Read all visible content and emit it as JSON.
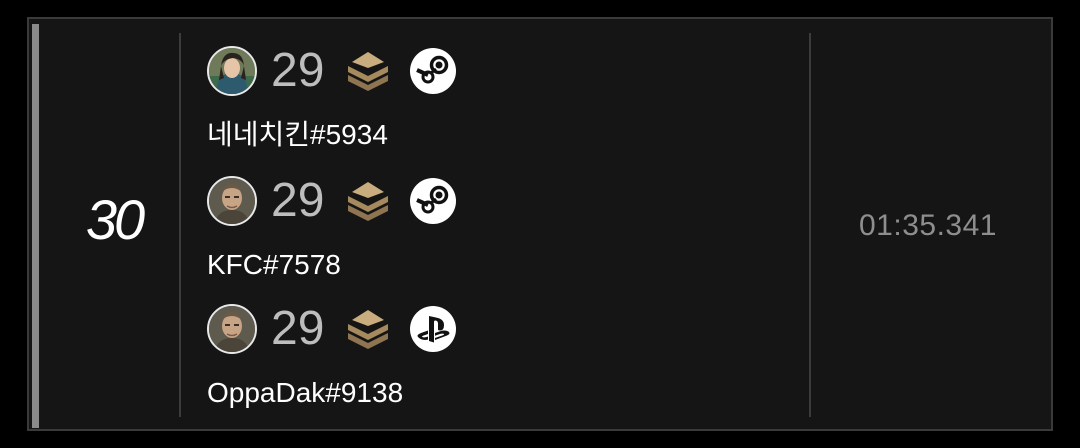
{
  "entry": {
    "rank": "30",
    "time": "01:35.341",
    "players": [
      {
        "level": "29",
        "name": "네네치킨#5934",
        "platform": "steam-icon"
      },
      {
        "level": "29",
        "name": "KFC#7578",
        "platform": "steam-icon"
      },
      {
        "level": "29",
        "name": "OppaDak#9138",
        "platform": "playstation-icon"
      }
    ]
  },
  "colors": {
    "background": "#000000",
    "card": "#151515",
    "rank_bar": "#8a8a8a",
    "level_text": "#bdbdbd",
    "time_text": "#8e8e8e",
    "rank_badge": "#b89a6a"
  }
}
